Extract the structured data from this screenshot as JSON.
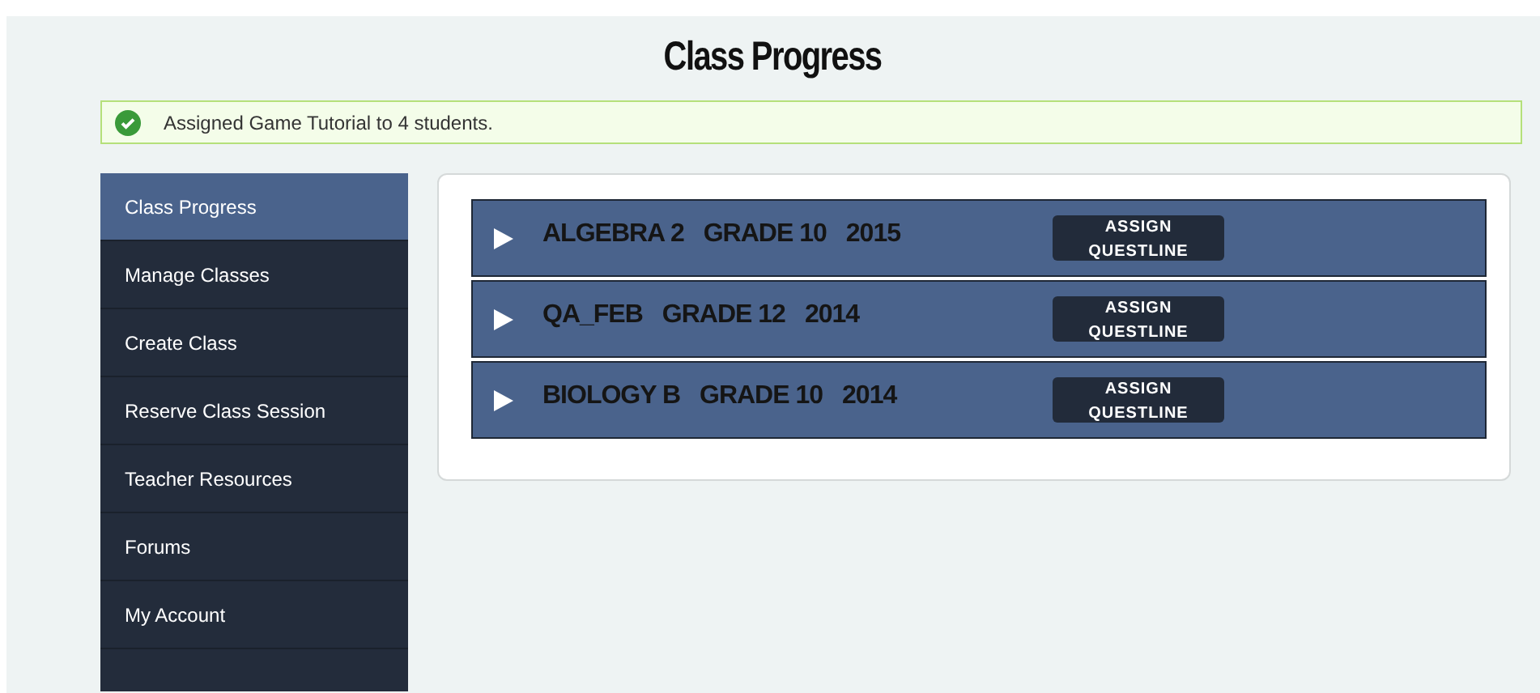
{
  "page_title": "Class Progress",
  "notice": {
    "text": "Assigned Game Tutorial to 4 students."
  },
  "sidebar": {
    "items": [
      {
        "label": "Class Progress",
        "selected": true
      },
      {
        "label": "Manage Classes",
        "selected": false
      },
      {
        "label": "Create Class",
        "selected": false
      },
      {
        "label": "Reserve Class Session",
        "selected": false
      },
      {
        "label": "Teacher Resources",
        "selected": false
      },
      {
        "label": "Forums",
        "selected": false
      },
      {
        "label": "My Account",
        "selected": false
      }
    ]
  },
  "classes": [
    {
      "name": "ALGEBRA 2",
      "grade": "GRADE 10",
      "year": "2015",
      "expanded": false,
      "button": "ASSIGN QUESTLINE"
    },
    {
      "name": "QA_FEB",
      "grade": "GRADE 12",
      "year": "2014",
      "expanded": false,
      "button": "ASSIGN QUESTLINE"
    },
    {
      "name": "BIOLOGY B",
      "grade": "GRADE 10",
      "year": "2014",
      "expanded": false,
      "button": "ASSIGN QUESTLINE"
    }
  ]
}
